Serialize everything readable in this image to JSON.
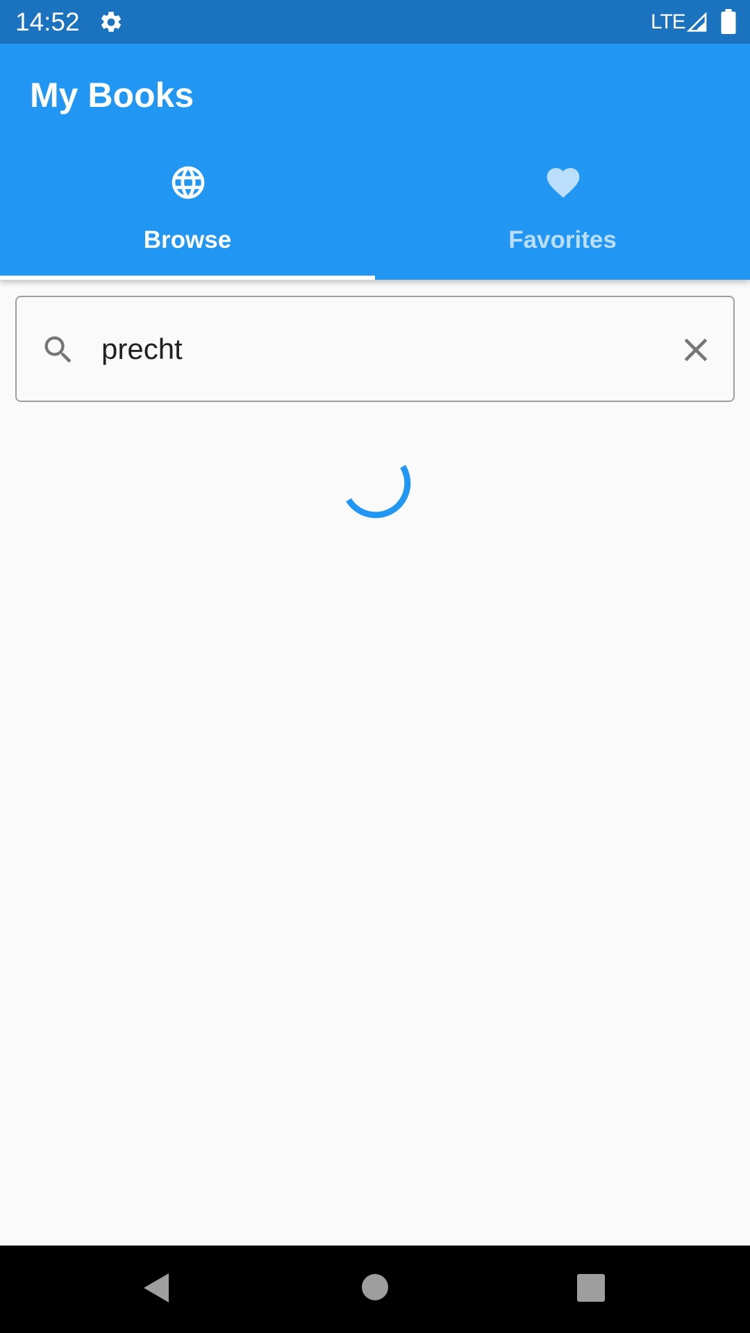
{
  "status_bar": {
    "time": "14:52",
    "network": "LTE",
    "icons": [
      "gear-icon",
      "signal-icon",
      "battery-icon"
    ]
  },
  "app_bar": {
    "title": "My Books",
    "background_color": "#2196f3",
    "tabs": [
      {
        "label": "Browse",
        "icon": "globe-icon",
        "selected": true
      },
      {
        "label": "Favorites",
        "icon": "heart-icon",
        "selected": false
      }
    ]
  },
  "search": {
    "value": "precht",
    "icon": "search-icon",
    "clear_icon": "close-icon"
  },
  "loading": {
    "icon": "loading-spinner",
    "color": "#2196f3"
  },
  "nav_bar": {
    "buttons": [
      "back-icon",
      "home-icon",
      "recents-icon"
    ]
  }
}
